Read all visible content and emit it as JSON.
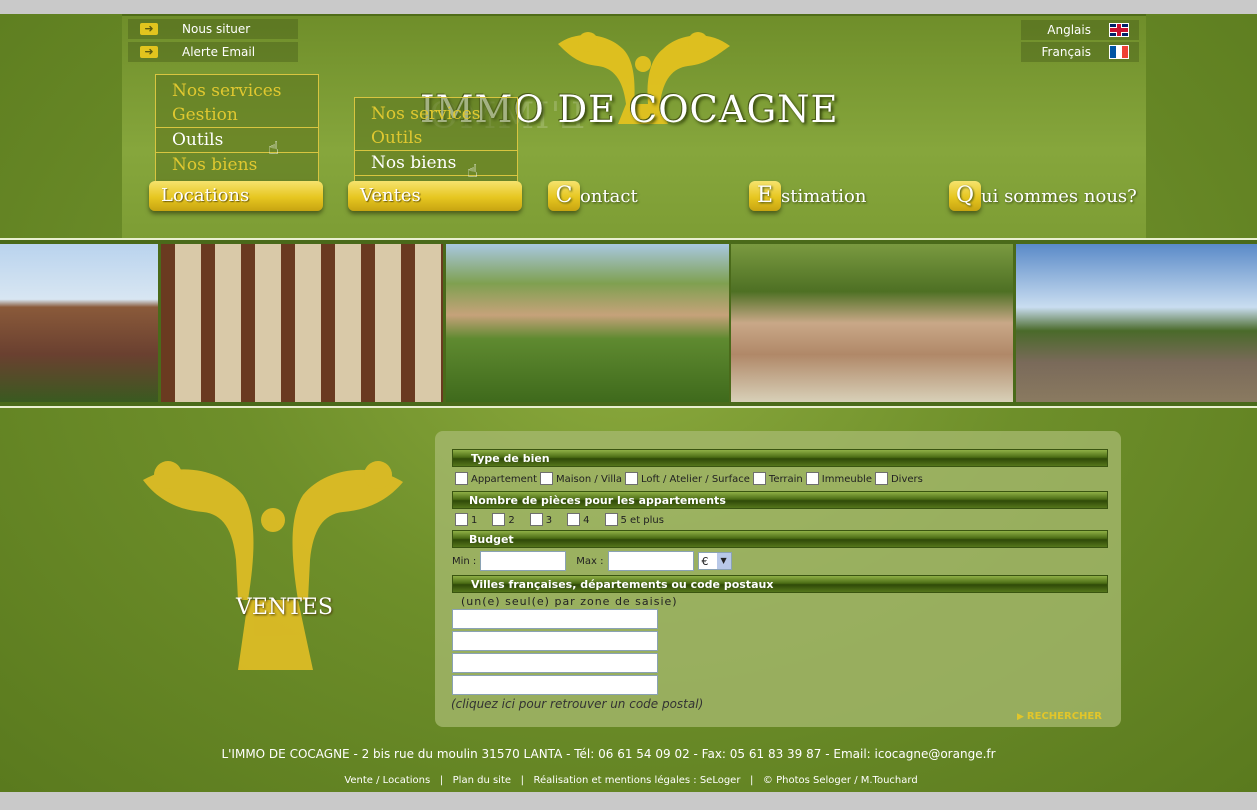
{
  "top_links": [
    {
      "label": "Nous situer",
      "icon": "arrow-right-icon"
    },
    {
      "label": "Alerte Email",
      "icon": "arrow-right-icon"
    }
  ],
  "languages": [
    {
      "label": "Anglais",
      "flag": "uk-flag-icon"
    },
    {
      "label": "Français",
      "flag": "fr-flag-icon"
    }
  ],
  "brand": {
    "name": "L'IMMO DE COCAGNE",
    "name_visible": "IMMO DE COCAGNE"
  },
  "dropdown_locations": {
    "items": [
      "Nos services",
      "Gestion",
      "Outils",
      "Nos biens"
    ],
    "active": "Outils"
  },
  "dropdown_ventes": {
    "items": [
      "Nos services",
      "Outils",
      "Nos biens"
    ],
    "active": "Nos biens"
  },
  "nav": {
    "locations": "Locations",
    "ventes": "Ventes",
    "contact": {
      "cap": "C",
      "rest": "ontact"
    },
    "estimation": {
      "cap": "E",
      "rest": "stimation"
    },
    "qui": {
      "cap": "Q",
      "rest": "ui sommes nous?"
    }
  },
  "section_title": "VENTES",
  "search": {
    "type_title": "Type de bien",
    "types": [
      "Appartement",
      "Maison / Villa",
      "Loft / Atelier / Surface",
      "Terrain",
      "Immeuble",
      "Divers"
    ],
    "rooms_title": "Nombre de pièces pour les appartements",
    "rooms": [
      "1",
      "2",
      "3",
      "4",
      "5 et plus"
    ],
    "budget_title": "Budget",
    "min_label": "Min :",
    "max_label": "Max :",
    "currency": "€",
    "cities_title": "Villes françaises, départements ou code postaux",
    "cities_hint": "(un(e) seul(e) par zone de saisie)",
    "postal_link": "(cliquez ici pour retrouver un code postal)",
    "search_button": "RECHERCHER"
  },
  "footer": {
    "address": "L'IMMO DE COCAGNE - 2 bis rue du moulin  31570   LANTA - Tél: 06 61 54 09 02 - Fax: 05 61 83 39 87 - Email: icocagne@orange.fr",
    "links": [
      "Vente / Locations",
      "Plan du site",
      "Réalisation et mentions légales : SeLoger",
      "© Photos Seloger / M.Touchard"
    ]
  },
  "colors": {
    "olive": "#6e8f2a",
    "gold": "#e6c620",
    "panel": "#a5b96e"
  }
}
